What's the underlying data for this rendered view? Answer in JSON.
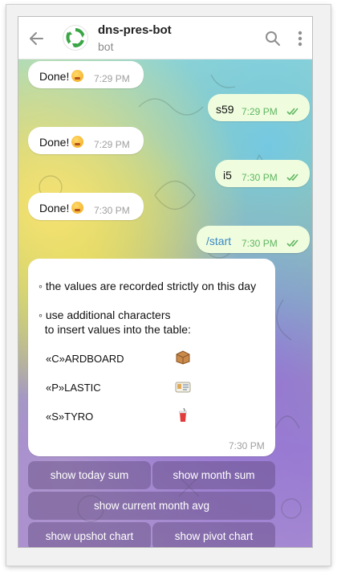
{
  "header": {
    "back_icon": "arrow-left-icon",
    "avatar_icon": "recycle-icon",
    "title": "dns-pres-bot",
    "subtitle": "bot",
    "search_icon": "search-icon",
    "menu_icon": "more-vertical-icon"
  },
  "colors": {
    "outgoing_bubble": "#effdde",
    "incoming_bubble": "#ffffff",
    "time_out": "#5fb561",
    "command_link": "#3a87c6",
    "keyboard_button": "#5a4678"
  },
  "messages": [
    {
      "direction": "in",
      "text": "Done!",
      "emoji": "grimacing-emoji",
      "time": "7:29 PM"
    },
    {
      "direction": "out",
      "text": "s59",
      "time": "7:29 PM",
      "status": "read-double-check-icon"
    },
    {
      "direction": "in",
      "text": "Done!",
      "emoji": "grimacing-emoji",
      "time": "7:29 PM"
    },
    {
      "direction": "out",
      "text": "i5",
      "time": "7:30 PM",
      "status": "read-double-check-icon"
    },
    {
      "direction": "in",
      "text": "Done!",
      "emoji": "grimacing-emoji",
      "time": "7:30 PM"
    },
    {
      "direction": "out",
      "text": "/start",
      "time": "7:30 PM",
      "status": "read-double-check-icon"
    }
  ],
  "info_message": {
    "line1": "◦ the values are recorded strictly on this day",
    "line2": "◦ use additional characters",
    "line3": "  to insert values into the table:",
    "items": [
      {
        "label": "«C»ARDBOARD",
        "icon": "package-box-icon"
      },
      {
        "label": "«P»LASTIC",
        "icon": "id-card-icon"
      },
      {
        "label": "«S»TYRO",
        "icon": "cup-with-straw-icon"
      }
    ],
    "time": "7:30 PM"
  },
  "keyboard": {
    "show_today_sum": "show today sum",
    "show_month_sum": "show month sum",
    "show_current_month_avg": "show current month avg",
    "show_upshot_chart": "show upshot chart",
    "show_pivot_chart": "show pivot chart"
  }
}
